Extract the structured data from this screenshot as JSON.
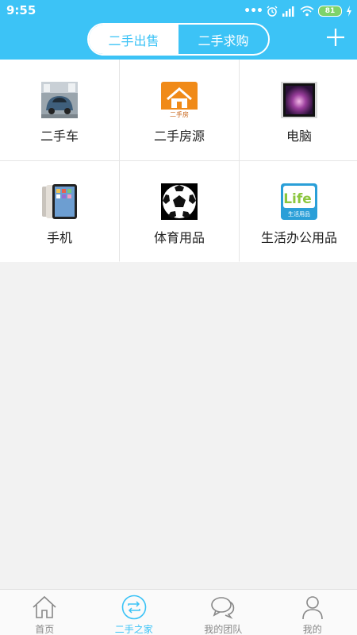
{
  "status_bar": {
    "time": "9:55",
    "battery": "81"
  },
  "header": {
    "tabs": [
      {
        "label": "二手出售",
        "active": true
      },
      {
        "label": "二手求购",
        "active": false
      }
    ],
    "add_icon": "plus-icon"
  },
  "categories": [
    {
      "label": "二手车",
      "icon": "used-car-image"
    },
    {
      "label": "二手房源",
      "icon": "house-image",
      "icon_text": "二手房"
    },
    {
      "label": "电脑",
      "icon": "computer-image"
    },
    {
      "label": "手机",
      "icon": "phone-image"
    },
    {
      "label": "体育用品",
      "icon": "soccer-ball-image"
    },
    {
      "label": "生活办公用品",
      "icon": "life-goods-image",
      "icon_text": "Life",
      "icon_subtext": "生活用品"
    }
  ],
  "tab_bar": {
    "items": [
      {
        "label": "首页",
        "icon": "home-icon",
        "active": false
      },
      {
        "label": "二手之家",
        "icon": "exchange-icon",
        "active": true
      },
      {
        "label": "我的团队",
        "icon": "chat-bubbles-icon",
        "active": false
      },
      {
        "label": "我的",
        "icon": "user-icon",
        "active": false
      }
    ]
  },
  "colors": {
    "accent": "#3cc3f6",
    "background": "#f2f2f2"
  }
}
